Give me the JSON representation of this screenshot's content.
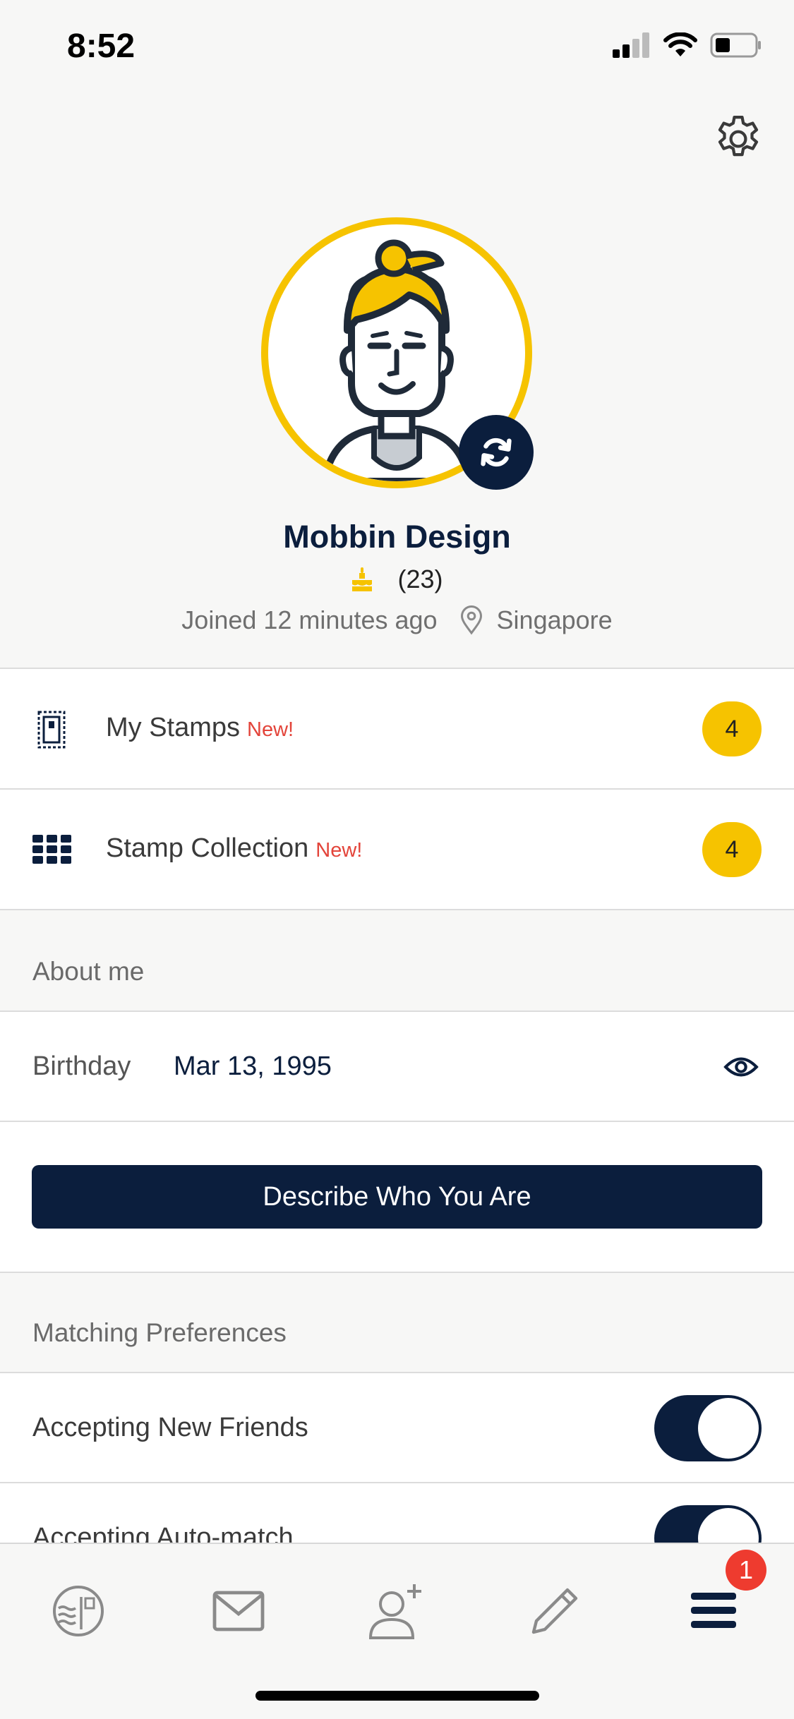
{
  "status_bar": {
    "time": "8:52"
  },
  "profile": {
    "name": "Mobbin Design",
    "age": "(23)",
    "joined": "Joined 12 minutes ago",
    "location": "Singapore"
  },
  "menu": {
    "my_stamps": {
      "label": "My Stamps",
      "new_tag": "New!",
      "count": "4"
    },
    "stamp_collection": {
      "label": "Stamp Collection",
      "new_tag": "New!",
      "count": "4"
    }
  },
  "about": {
    "section_title": "About me",
    "birthday_label": "Birthday",
    "birthday_value": "Mar 13, 1995",
    "describe_button": "Describe Who You Are"
  },
  "matching": {
    "section_title": "Matching Preferences",
    "accepting_new_friends": {
      "label": "Accepting New Friends",
      "enabled": true
    },
    "accepting_auto_match": {
      "label": "Accepting Auto-match",
      "enabled": true
    }
  },
  "tabbar": {
    "tabs": [
      "stamp-postcard-icon",
      "mail-icon",
      "add-friend-icon",
      "pencil-icon",
      "menu-icon"
    ],
    "notification_count": "1"
  },
  "colors": {
    "navy": "#0b1e3d",
    "accent_yellow": "#f6c300",
    "new_red": "#e3443a",
    "badge_red": "#ee3b2f"
  }
}
